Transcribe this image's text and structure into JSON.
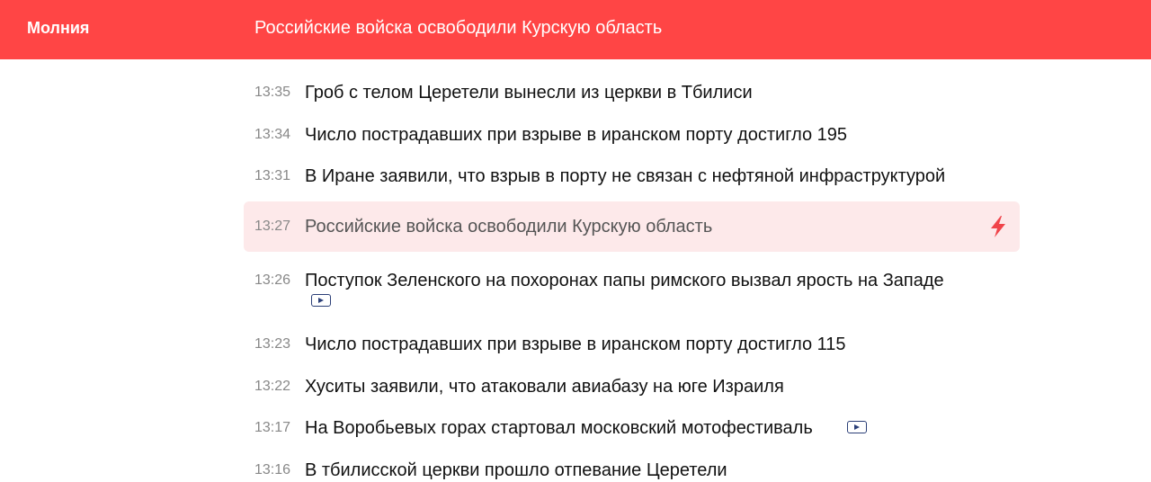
{
  "banner": {
    "label": "Молния",
    "headline": "Российские войска освободили Курскую область"
  },
  "feed": {
    "items": [
      {
        "time": "13:35",
        "title": "Гроб с телом Церетели вынесли из церкви в Тбилиси"
      },
      {
        "time": "13:34",
        "title": "Число пострадавших при взрыве в иранском порту достигло 195"
      },
      {
        "time": "13:31",
        "title": "В Иране заявили, что взрыв в порту не связан с нефтяной инфраструктурой"
      },
      {
        "time": "13:27",
        "title": "Российские войска освободили Курскую область",
        "icon": "lightning-icon",
        "highlighted": true
      },
      {
        "time": "13:26",
        "title": "Поступок Зеленского на похоронах папы римского вызвал ярость на Западе",
        "icon": "video-icon"
      },
      {
        "time": "13:23",
        "title": "Число пострадавших при взрыве в иранском порту достигло 115"
      },
      {
        "time": "13:22",
        "title": "Хуситы заявили, что атаковали авиабазу на юге Израиля"
      },
      {
        "time": "13:17",
        "title": "На Воробьевых горах стартовал московский мотофестиваль",
        "icon": "video-icon"
      },
      {
        "time": "13:16",
        "title": "В тбилисской церкви прошло отпевание Церетели"
      }
    ]
  },
  "colors": {
    "banner_bg": "#ff4545",
    "highlight_bg": "#fde9ea",
    "lightning": "#f0444a",
    "video_icon": "#2b3f77"
  }
}
